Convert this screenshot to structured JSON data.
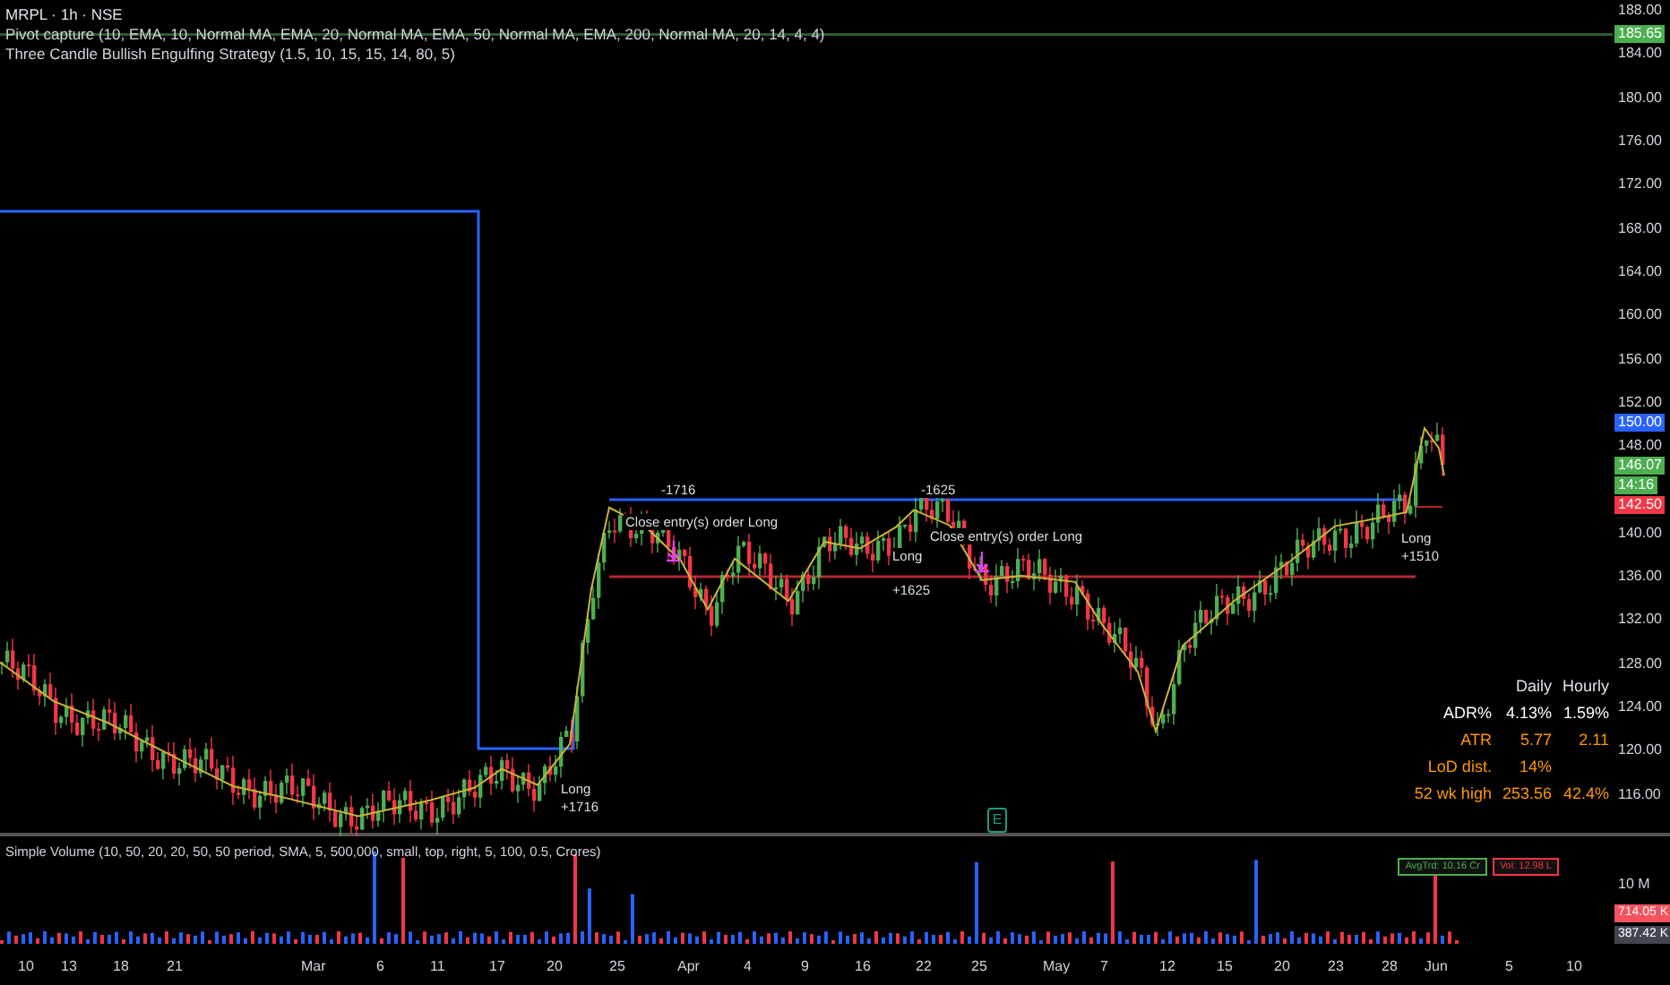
{
  "symbol_title": "MRPL · 1h · NSE",
  "indicators": [
    "Pivot capture (10, EMA, 10, Normal MA, EMA, 20, Normal MA, EMA, 50, Normal MA, EMA, 200, Normal MA, 20, 14, 4, 4)",
    "Three Candle Bullish Engulfing Strategy (1.5, 10, 15, 15, 14, 80, 5)"
  ],
  "price_axis": {
    "ticks": [
      "188.00",
      "184.00",
      "180.00",
      "176.00",
      "172.00",
      "168.00",
      "164.00",
      "160.00",
      "156.00",
      "152.00",
      "148.00",
      "140.00",
      "136.00",
      "132.00",
      "128.00",
      "124.00",
      "120.00",
      "116.00"
    ]
  },
  "price_tags": [
    {
      "text": "185.65",
      "color": "#4caf50"
    },
    {
      "text": "150.00",
      "color": "#2962ff"
    },
    {
      "text": "146.07",
      "color": "#4caf50"
    },
    {
      "text": "14:16",
      "color": "#4caf50"
    },
    {
      "text": "142.50",
      "color": "#f23645"
    }
  ],
  "trade_labels": [
    "Long",
    "+1716",
    "-1716",
    "Close entry(s) order Long",
    "Long",
    "+1625",
    "-1625",
    "Close entry(s) order Long",
    "Long",
    "+1510"
  ],
  "earnings_marker": "E",
  "stats_table": {
    "columns": [
      "Daily",
      "Hourly"
    ],
    "rows": [
      {
        "label": "ADR%",
        "values": [
          "4.13%",
          "1.59%"
        ],
        "color": "#ffffff"
      },
      {
        "label": "ATR",
        "values": [
          "5.77",
          "2.11"
        ],
        "color": "#ff9800"
      },
      {
        "label": "LoD dist.",
        "values": [
          "14%"
        ],
        "color": "#ff9800"
      },
      {
        "label": "52 wk high",
        "values": [
          "253.56",
          "42.4%"
        ],
        "color": "#ff9800"
      }
    ]
  },
  "volume": {
    "title": "Simple Volume (10, 50, 20, 20, 50, 50 period, SMA, 5, 500,000, small, top, right, 5, 100, 0.5, Crores)",
    "badges": [
      {
        "text": "AvgTrd: 10.16 Cr",
        "color": "#4caf50"
      },
      {
        "text": "Vol: 12.98 L",
        "color": "#f23645"
      }
    ],
    "axis_label": "10 M",
    "tags": [
      {
        "text": "714.05 K",
        "color": "#f7525f"
      },
      {
        "text": "387.42 K",
        "color": "#434651"
      }
    ]
  },
  "time_axis": [
    "10",
    "13",
    "18",
    "21",
    "Mar",
    "6",
    "11",
    "17",
    "20",
    "25",
    "Apr",
    "4",
    "9",
    "16",
    "22",
    "25",
    "May",
    "7",
    "12",
    "15",
    "20",
    "23",
    "28",
    "Jun",
    "5",
    "10"
  ]
}
